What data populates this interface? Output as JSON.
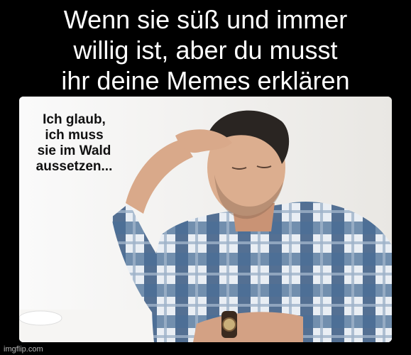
{
  "meme": {
    "caption_lines": [
      "Wenn sie süß und immer",
      "willig ist, aber du musst",
      "ihr deine Memes erklären"
    ],
    "speech_lines": [
      "Ich glaub,",
      "ich muss",
      "sie im Wald",
      "aussetzen..."
    ],
    "watermark": "imgflip.com"
  }
}
